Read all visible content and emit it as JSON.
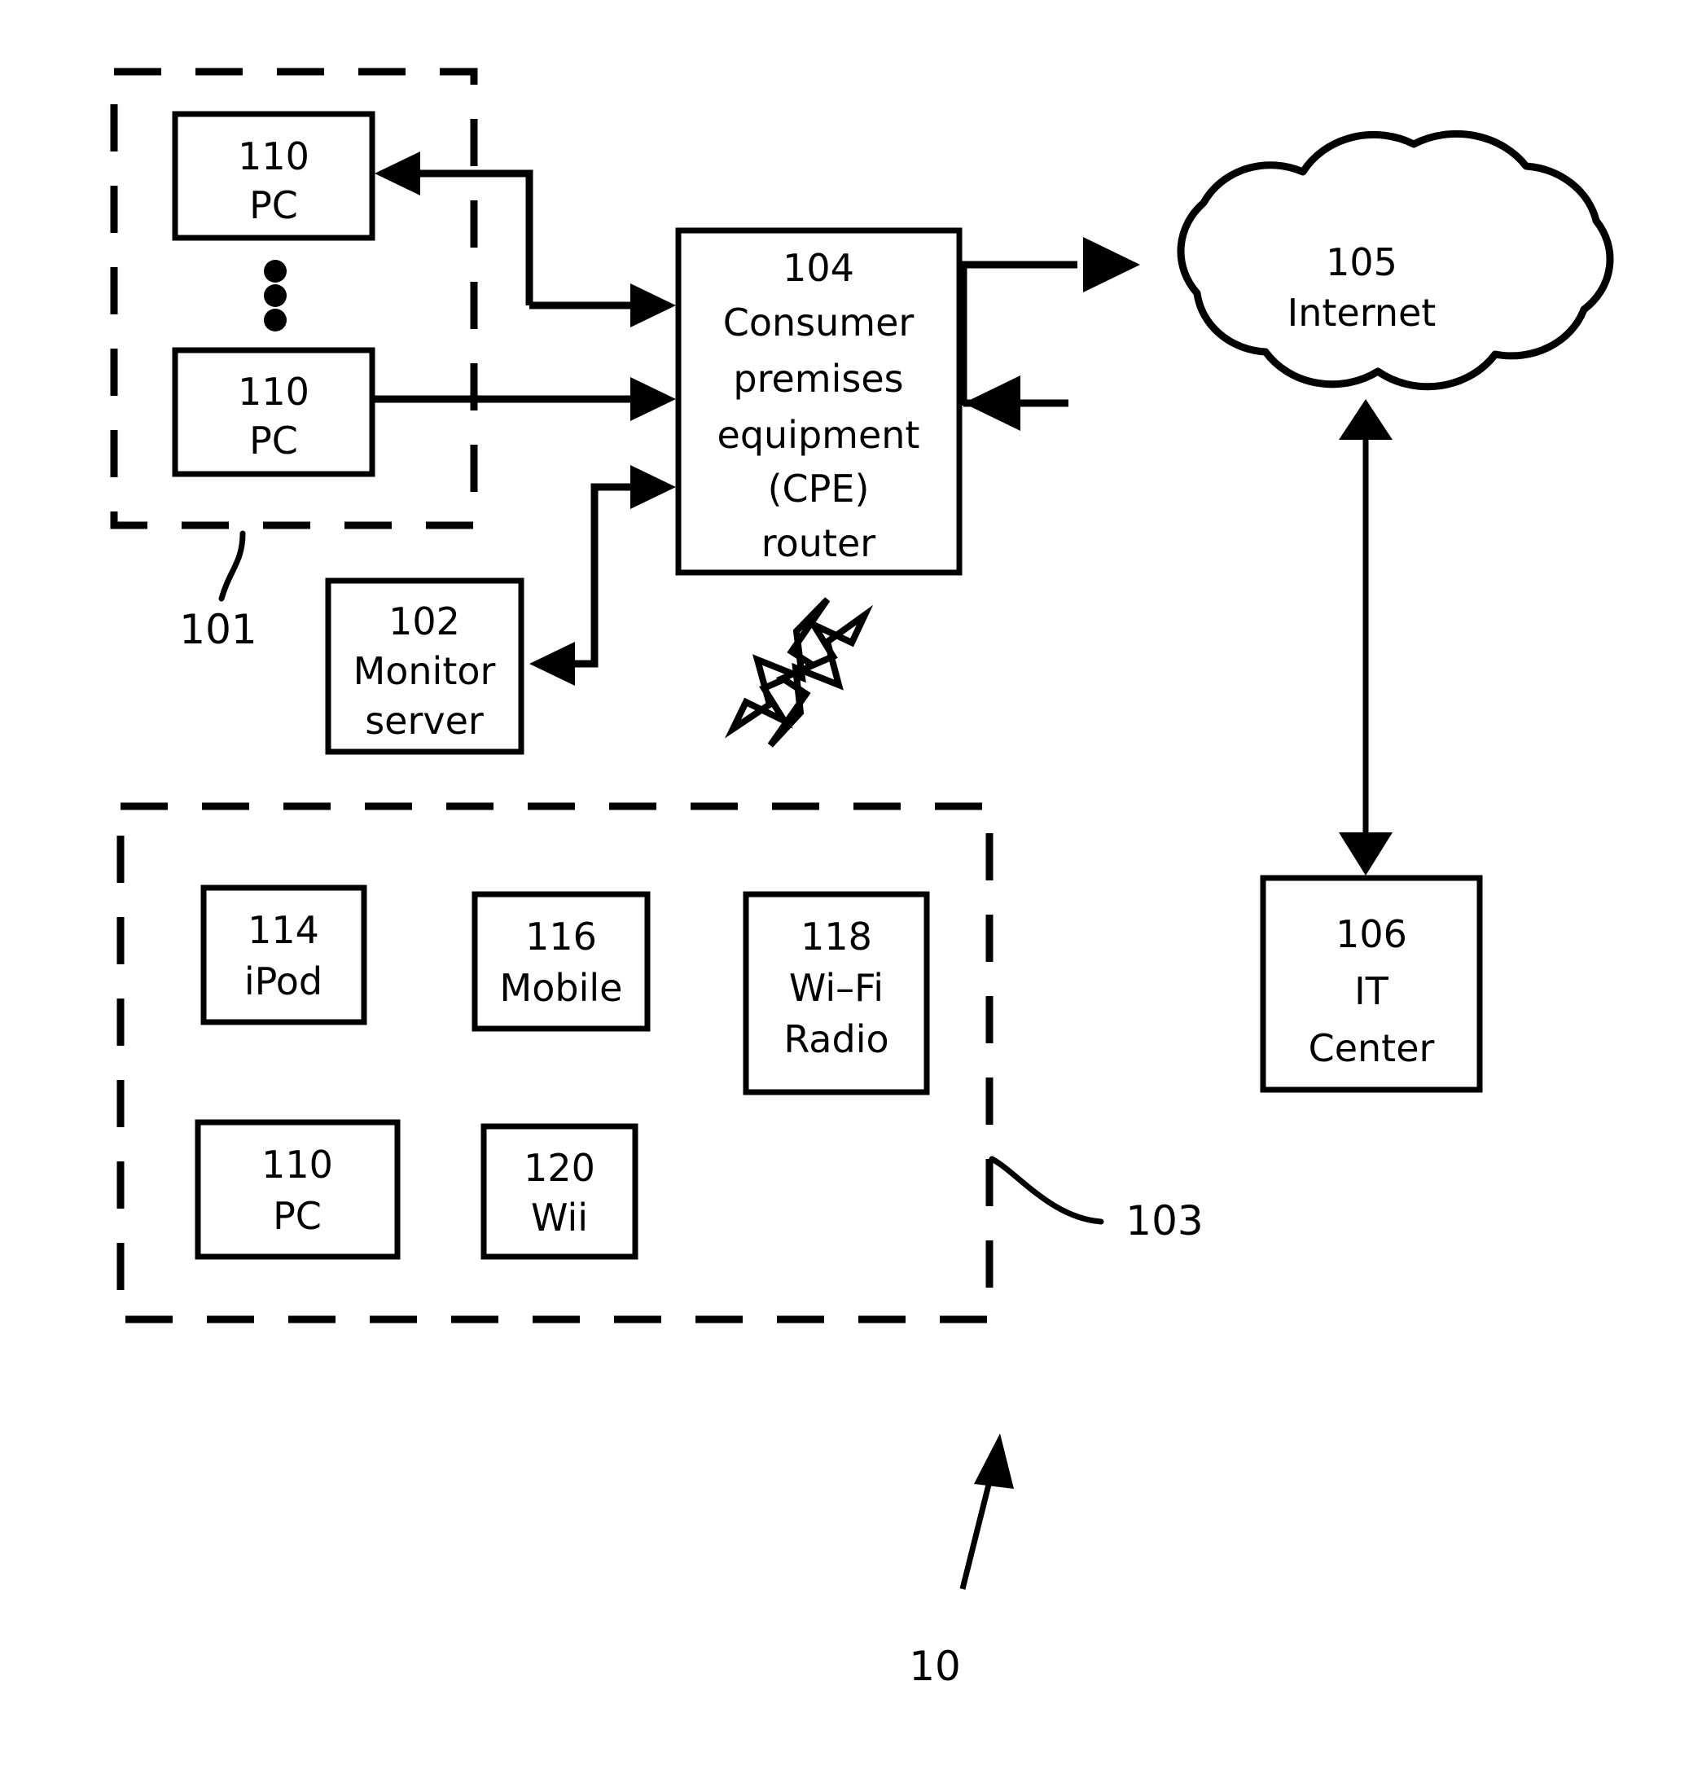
{
  "figure": {
    "number": "10",
    "regions": [
      {
        "id": "101",
        "label": "101",
        "name": "home-network-region"
      },
      {
        "id": "103",
        "label": "103",
        "name": "wireless-devices-region"
      }
    ],
    "nodes": [
      {
        "id": "pc-top",
        "ref": "110",
        "name": "PC",
        "lines": [
          "110",
          "PC"
        ]
      },
      {
        "id": "pc-bottom",
        "ref": "110",
        "name": "PC",
        "lines": [
          "110",
          "PC"
        ]
      },
      {
        "id": "cpe",
        "ref": "104",
        "name": "Consumer premises equipment (CPE) router",
        "lines": [
          "104",
          "Consumer",
          "premises",
          "equipment",
          "(CPE)",
          "router"
        ]
      },
      {
        "id": "monitor",
        "ref": "102",
        "name": "Monitor server",
        "lines": [
          "102",
          "Monitor",
          "server"
        ]
      },
      {
        "id": "internet",
        "ref": "105",
        "name": "Internet",
        "lines": [
          "105",
          "Internet"
        ]
      },
      {
        "id": "it-center",
        "ref": "106",
        "name": "IT Center",
        "lines": [
          "106",
          "IT",
          "Center"
        ]
      },
      {
        "id": "ipod",
        "ref": "114",
        "name": "iPod",
        "lines": [
          "114",
          "iPod"
        ]
      },
      {
        "id": "mobile",
        "ref": "116",
        "name": "Mobile",
        "lines": [
          "116",
          "Mobile"
        ]
      },
      {
        "id": "wifi-radio",
        "ref": "118",
        "name": "Wi-Fi Radio",
        "lines": [
          "118",
          "Wi–Fi",
          "Radio"
        ]
      },
      {
        "id": "pc-wireless",
        "ref": "110",
        "name": "PC",
        "lines": [
          "110",
          "PC"
        ]
      },
      {
        "id": "wii",
        "ref": "120",
        "name": "Wii",
        "lines": [
          "120",
          "Wii"
        ]
      }
    ],
    "colors": {
      "stroke": "#000000",
      "background": "#ffffff"
    }
  }
}
